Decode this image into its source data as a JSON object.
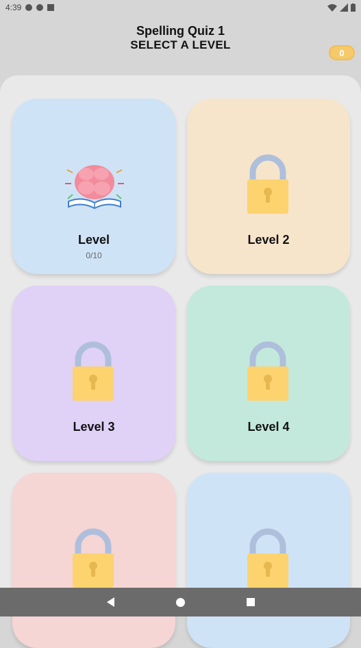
{
  "status_bar": {
    "time": "4:39"
  },
  "header": {
    "title": "Spelling Quiz 1",
    "subtitle": "SELECT A LEVEL"
  },
  "coins": "0",
  "levels": [
    {
      "label": "Level",
      "progress": "0/10",
      "locked": false,
      "color": "#cfe3f7"
    },
    {
      "label": "Level 2",
      "locked": true,
      "color": "#f6e5cb"
    },
    {
      "label": "Level 3",
      "locked": true,
      "color": "#e0d1f7"
    },
    {
      "label": "Level 4",
      "locked": true,
      "color": "#c3e9dc"
    },
    {
      "label": "",
      "locked": true,
      "color": "#f6d5d5"
    },
    {
      "label": "",
      "locked": true,
      "color": "#cfe3f7"
    }
  ]
}
